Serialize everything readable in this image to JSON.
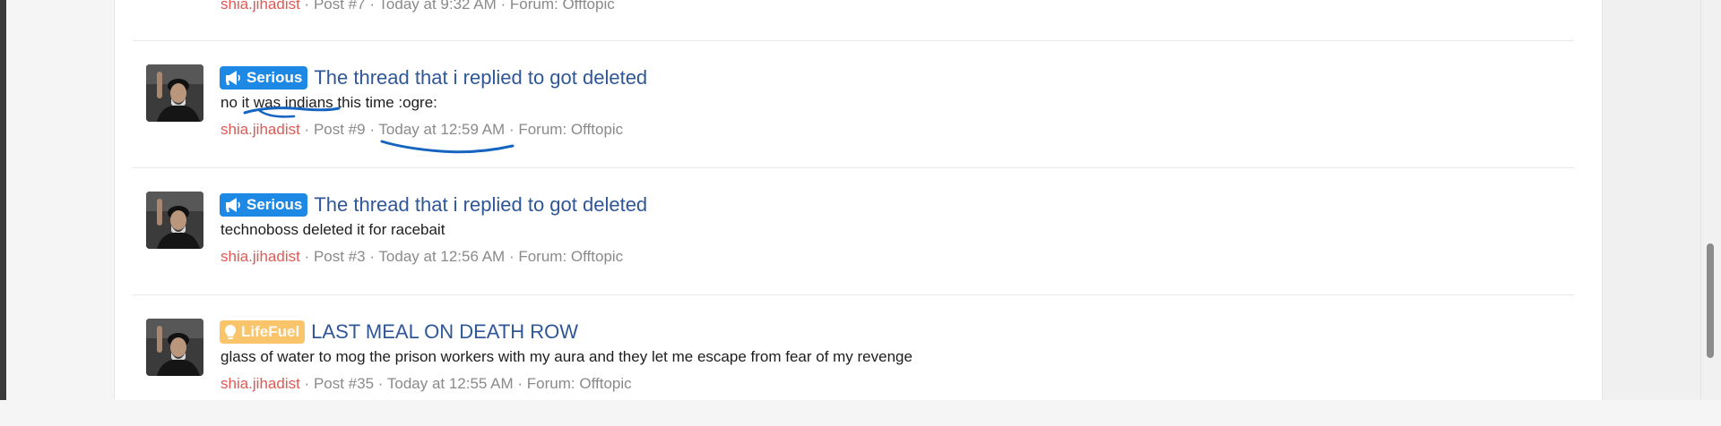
{
  "colors": {
    "accent_link": "#2f5797",
    "username": "#e05a55",
    "serious": "#1e88e5",
    "lifefuel": "#f9c46a",
    "annotation": "#1565c0"
  },
  "results": [
    {
      "prefix": "",
      "title": "",
      "snippet": "",
      "user": "shia.jihadist",
      "post": "Post #7",
      "time": "Today at 9:32 AM",
      "forum": "Forum: Offtopic"
    },
    {
      "prefix": "Serious",
      "prefix_icon": "megaphone-icon",
      "title": "The thread that i replied to got deleted",
      "snippet": "no it was indians this time :ogre:",
      "user": "shia.jihadist",
      "post": "Post #9",
      "time": "Today at 12:59 AM",
      "forum": "Forum: Offtopic"
    },
    {
      "prefix": "Serious",
      "prefix_icon": "megaphone-icon",
      "title": "The thread that i replied to got deleted",
      "snippet": "technoboss deleted it for racebait",
      "user": "shia.jihadist",
      "post": "Post #3",
      "time": "Today at 12:56 AM",
      "forum": "Forum: Offtopic"
    },
    {
      "prefix": "LifeFuel",
      "prefix_icon": "lightbulb-icon",
      "title": "LAST MEAL ON DEATH ROW",
      "snippet": "glass of water to mog the prison workers with my aura and they let me escape from fear of my revenge",
      "user": "shia.jihadist",
      "post": "Post #35",
      "time": "Today at 12:55 AM",
      "forum": "Forum: Offtopic"
    }
  ],
  "sep": " · "
}
